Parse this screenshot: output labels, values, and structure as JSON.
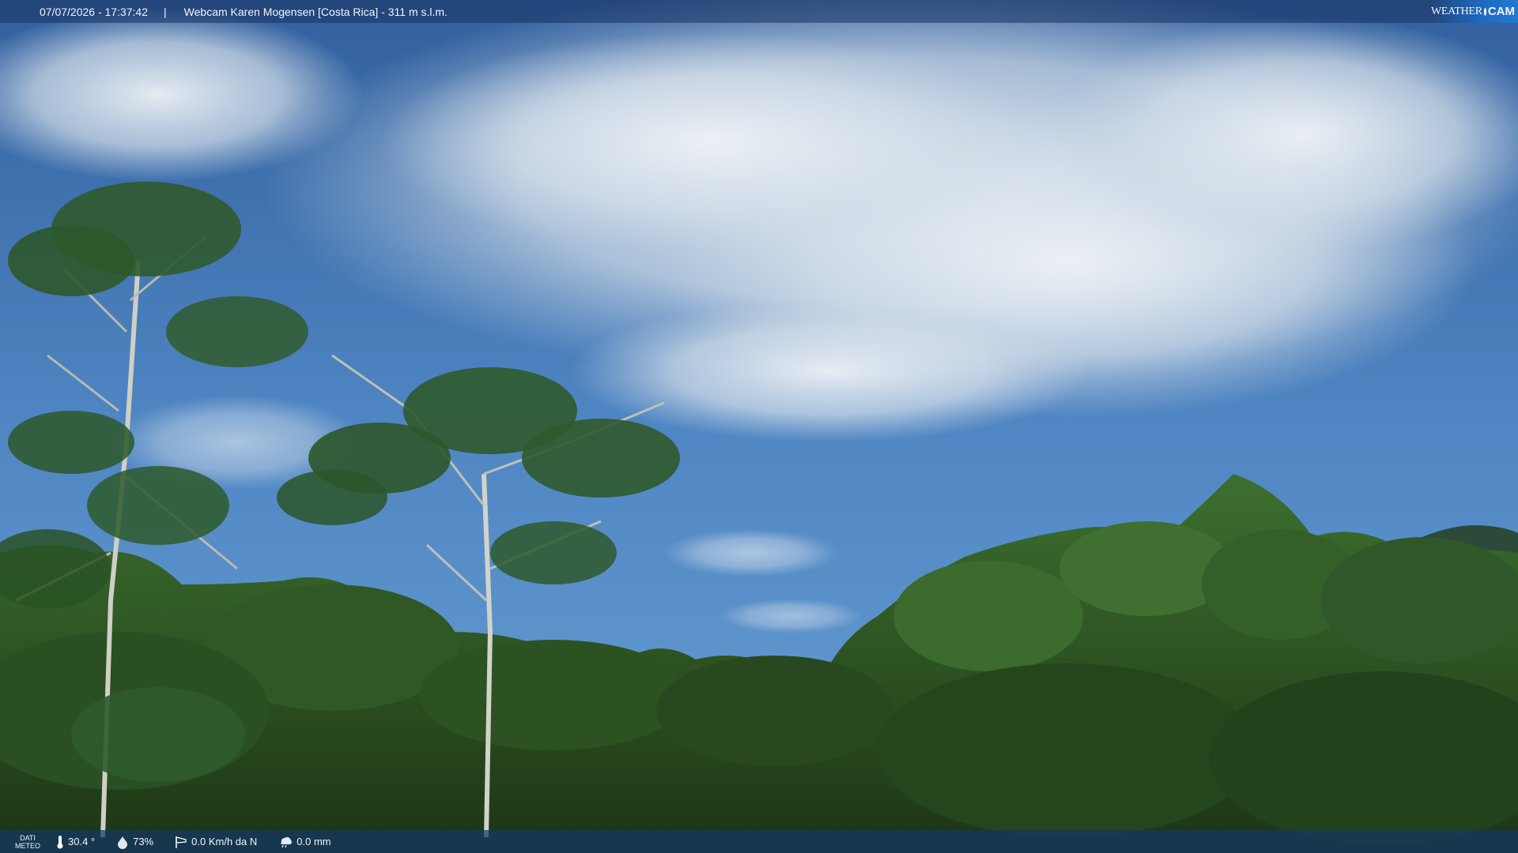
{
  "header": {
    "timestamp": "07/07/2026 - 17:37:42",
    "separator": "|",
    "title": "Webcam Karen Mogensen [Costa Rica] - 311 m s.l.m."
  },
  "watermark": {
    "word1": "WEATHER",
    "word2": "CAM"
  },
  "footer": {
    "section_label_line1": "DATI",
    "section_label_line2": "METEO",
    "temperature": "30.4 °",
    "humidity": "73%",
    "wind": "0.0 Km/h da N",
    "rain": "0.0 mm"
  },
  "icons": {
    "temperature": "thermometer-icon",
    "humidity": "humidity-drop-icon",
    "wind": "wind-sock-icon",
    "rain": "rain-cloud-icon"
  },
  "colors": {
    "sky_top": "#3b6fb1",
    "sky_bottom": "#5d93cd",
    "cloud": "#e7edf3",
    "foliage_dark": "#1f3d19",
    "foliage_mid": "#3a6b2c",
    "bar": "#16325f"
  }
}
